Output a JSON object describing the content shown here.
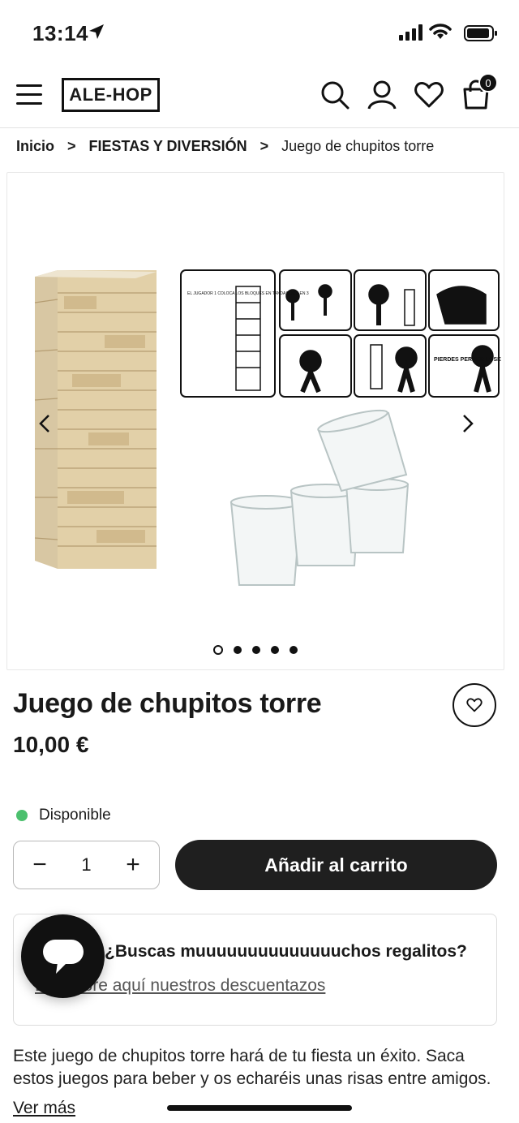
{
  "status": {
    "time": "13:14"
  },
  "header": {
    "logo": "ALE-HOP",
    "cart_count": "0"
  },
  "breadcrumb": {
    "home": "Inicio",
    "separator": ">",
    "category": "FIESTAS Y DIVERSIÓN",
    "current": "Juego de chupitos torre"
  },
  "gallery": {
    "instruction_texts": {
      "player1": "EL JUGADOR 1 COLOCA LOS BLOQUES EN TANDAS DE 3 EN 3",
      "pierdes": "PIERDES PERDER LOSE"
    },
    "slides": 5,
    "active_slide": 1
  },
  "product": {
    "title": "Juego de chupitos torre",
    "price": "10,00 €",
    "availability": "Disponible",
    "quantity": "1",
    "add_to_cart": "Añadir al carrito"
  },
  "promo": {
    "question": "¿Buscas muuuuuuuuuuuuuuchos regalitos?",
    "link": "Descubre aquí nuestros descuentazos"
  },
  "description": {
    "text": "Este juego de chupitos torre hará de tu fiesta un éxito. Saca estos juegos para beber y os echaréis unas risas entre amigos.",
    "more_label": "Ver más"
  },
  "colors": {
    "accent": "#1f1f1f",
    "available": "#4cc06e"
  }
}
